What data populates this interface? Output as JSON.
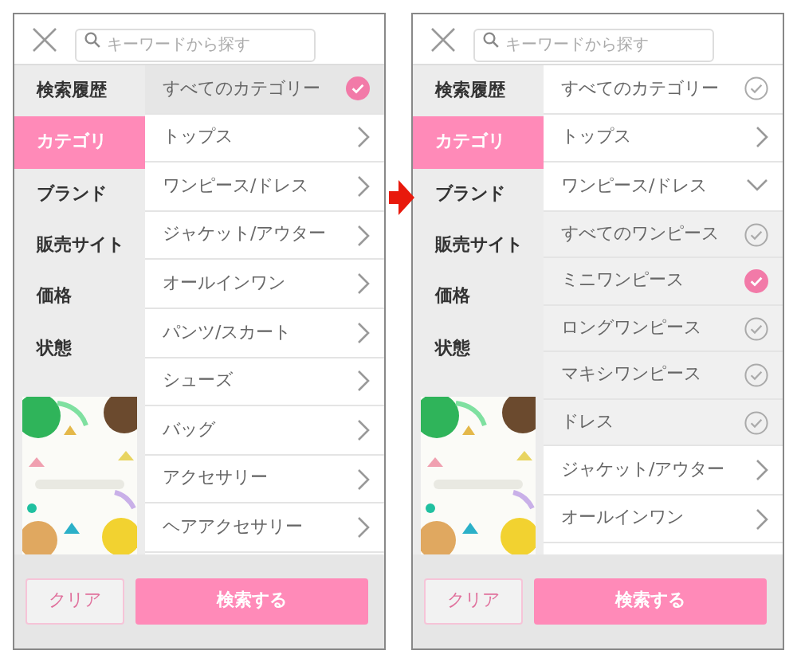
{
  "screens": [
    {
      "search": {
        "placeholder": "キーワードから探す"
      },
      "sidebar": {
        "items": [
          {
            "label": "検索履歴",
            "selected": false
          },
          {
            "label": "カテゴリ",
            "selected": true
          },
          {
            "label": "ブランド",
            "selected": false
          },
          {
            "label": "販売サイト",
            "selected": false
          },
          {
            "label": "価格",
            "selected": false
          },
          {
            "label": "状態",
            "selected": false
          }
        ]
      },
      "ad": {
        "kind": "picture"
      },
      "categories": [
        {
          "kind": "check",
          "label": "すべてのカテゴリー",
          "checked": true
        },
        {
          "kind": "category",
          "label": "トップス",
          "expanded": false
        },
        {
          "kind": "category",
          "label": "ワンピース/ドレス",
          "expanded": false
        },
        {
          "kind": "category",
          "label": "ジャケット/アウター",
          "expanded": false
        },
        {
          "kind": "category",
          "label": "オールインワン",
          "expanded": false
        },
        {
          "kind": "category",
          "label": "パンツ/スカート",
          "expanded": false
        },
        {
          "kind": "category",
          "label": "シューズ",
          "expanded": false
        },
        {
          "kind": "category",
          "label": "バッグ",
          "expanded": false
        },
        {
          "kind": "category",
          "label": "アクセサリー",
          "expanded": false
        },
        {
          "kind": "category",
          "label": "ヘアアクセサリー",
          "expanded": false
        }
      ],
      "buttons": {
        "clear": "クリア",
        "search": "検索する"
      }
    },
    {
      "search": {
        "placeholder": "キーワードから探す"
      },
      "sidebar": {
        "items": [
          {
            "label": "検索履歴",
            "selected": false
          },
          {
            "label": "カテゴリ",
            "selected": true
          },
          {
            "label": "ブランド",
            "selected": false
          },
          {
            "label": "販売サイト",
            "selected": false
          },
          {
            "label": "価格",
            "selected": false
          },
          {
            "label": "状態",
            "selected": false
          }
        ]
      },
      "ad": {
        "kind": "picture"
      },
      "categories": [
        {
          "kind": "check",
          "label": "すべてのカテゴリー",
          "checked": false
        },
        {
          "kind": "category",
          "label": "トップス",
          "expanded": false
        },
        {
          "kind": "category",
          "label": "ワンピース/ドレス",
          "expanded": true,
          "children": [
            {
              "kind": "check",
              "label": "すべてのワンピース",
              "checked": false
            },
            {
              "kind": "check",
              "label": "ミニワンピース",
              "checked": true
            },
            {
              "kind": "check",
              "label": "ロングワンピース",
              "checked": false
            },
            {
              "kind": "check",
              "label": "マキシワンピース",
              "checked": false
            },
            {
              "kind": "check",
              "label": "ドレス",
              "checked": false
            }
          ]
        },
        {
          "kind": "category",
          "label": "ジャケット/アウター",
          "expanded": false
        },
        {
          "kind": "category",
          "label": "オールインワン",
          "expanded": false
        }
      ],
      "buttons": {
        "clear": "クリア",
        "search": "検索する"
      }
    }
  ]
}
